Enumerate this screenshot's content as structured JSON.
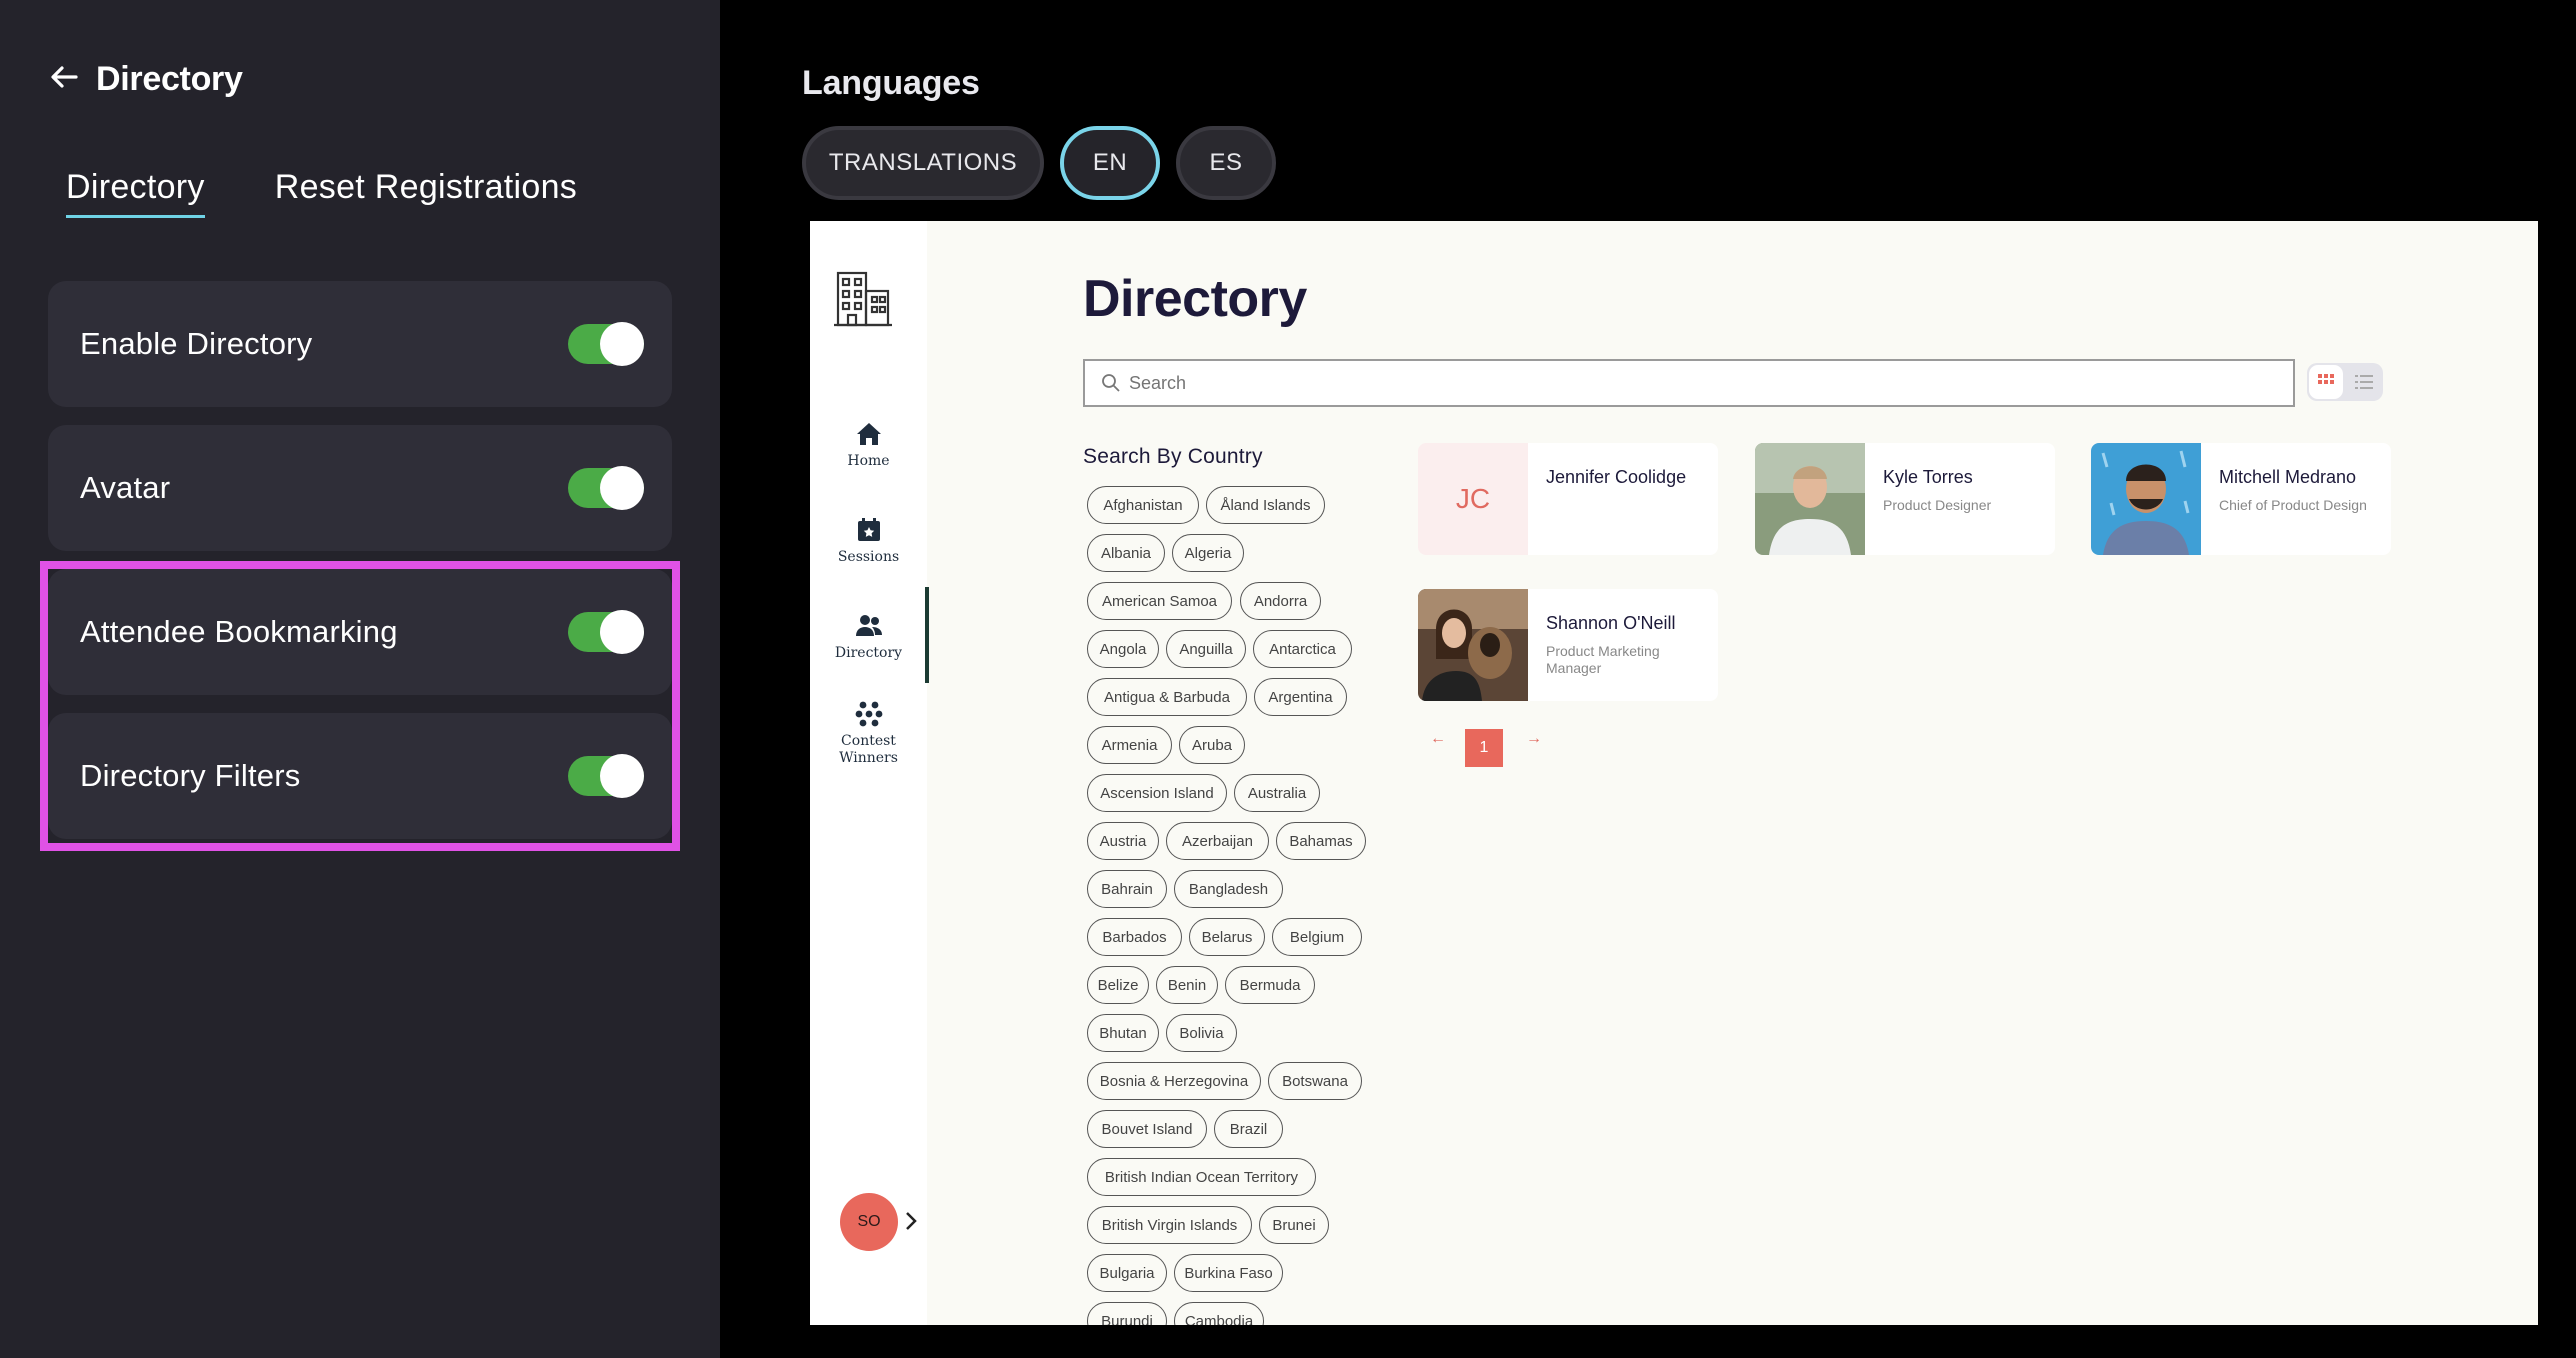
{
  "panel": {
    "title": "Directory",
    "tabs": [
      "Directory",
      "Reset Registrations"
    ],
    "settings": [
      {
        "label": "Enable Directory",
        "enabled": true
      },
      {
        "label": "Avatar",
        "enabled": true
      },
      {
        "label": "Attendee Bookmarking",
        "enabled": true
      },
      {
        "label": "Directory Filters",
        "enabled": true
      }
    ]
  },
  "languages": {
    "title": "Languages",
    "buttons": [
      "TRANSLATIONS",
      "EN",
      "ES"
    ],
    "active": "EN"
  },
  "preview": {
    "nav": [
      {
        "label": "Home",
        "icon": "home-icon"
      },
      {
        "label": "Sessions",
        "icon": "calendar-icon"
      },
      {
        "label": "Directory",
        "icon": "people-icon"
      },
      {
        "label": "Contest Winners",
        "icon": "dots-icon"
      }
    ],
    "user_initials": "SO",
    "title": "Directory",
    "search_placeholder": "Search",
    "country_title": "Search By Country",
    "countries": [
      "Afghanistan",
      "Åland Islands",
      "Albania",
      "Algeria",
      "American Samoa",
      "Andorra",
      "Angola",
      "Anguilla",
      "Antarctica",
      "Antigua & Barbuda",
      "Argentina",
      "Armenia",
      "Aruba",
      "Ascension Island",
      "Australia",
      "Austria",
      "Azerbaijan",
      "Bahamas",
      "Bahrain",
      "Bangladesh",
      "Barbados",
      "Belarus",
      "Belgium",
      "Belize",
      "Benin",
      "Bermuda",
      "Bhutan",
      "Bolivia",
      "Bosnia & Herzegovina",
      "Botswana",
      "Bouvet Island",
      "Brazil",
      "British Indian Ocean Territory",
      "British Virgin Islands",
      "Brunei",
      "Bulgaria",
      "Burkina Faso",
      "Burundi",
      "Cambodia"
    ],
    "people": [
      {
        "initials": "JC",
        "name": "Jennifer Coolidge",
        "role": ""
      },
      {
        "name": "Kyle Torres",
        "role": "Product Designer"
      },
      {
        "name": "Mitchell Medrano",
        "role": "Chief of Product Design"
      },
      {
        "name": "Shannon O'Neill",
        "role": "Product Marketing Manager"
      }
    ],
    "pager": {
      "prev": "←",
      "page": "1",
      "next": "→"
    },
    "accent": "#e8685c"
  },
  "colors": {
    "toggle_on": "#4bab47",
    "highlight": "#e052e6",
    "tab_underline": "#6fd3e6"
  }
}
